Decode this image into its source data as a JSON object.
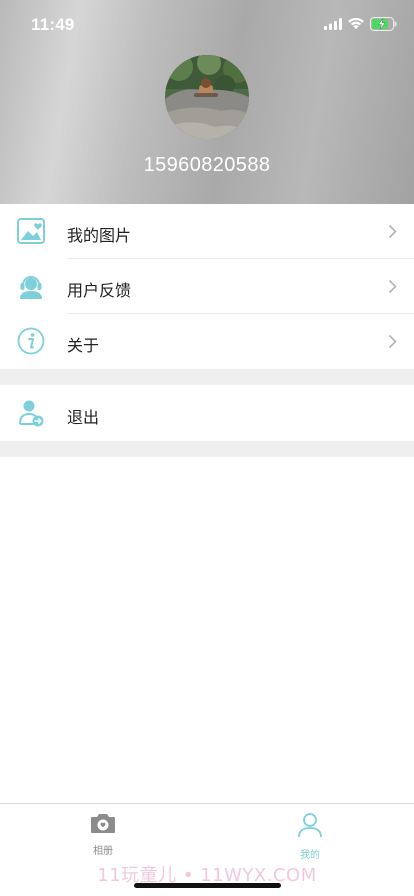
{
  "status_bar": {
    "time": "11:49"
  },
  "profile": {
    "phone": "15960820588"
  },
  "menu": {
    "items": [
      {
        "label": "我的图片",
        "icon": "picture-icon"
      },
      {
        "label": "用户反馈",
        "icon": "headset-icon"
      },
      {
        "label": "关于",
        "icon": "info-icon"
      }
    ],
    "logout": {
      "label": "退出",
      "icon": "user-logout-icon"
    }
  },
  "tabbar": {
    "tabs": [
      {
        "label": "相册",
        "icon": "camera-icon",
        "active": false
      },
      {
        "label": "我的",
        "icon": "person-icon",
        "active": true
      }
    ]
  },
  "watermark": "11玩童儿 • 11WYX.COM",
  "colors": {
    "accent": "#7dd0da",
    "inactive_tab": "#8c8c8c",
    "header_gray": "#b5b5b5"
  }
}
